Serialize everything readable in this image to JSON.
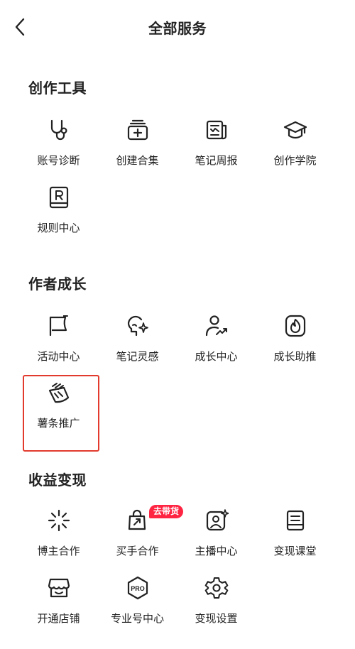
{
  "header": {
    "title": "全部服务",
    "back_icon": "chevron-left-icon"
  },
  "highlight_color": "#e23b2e",
  "badge_color": "#ff2442",
  "sections": [
    {
      "title": "创作工具",
      "items": [
        {
          "label": "账号诊断",
          "icon": "stethoscope-icon"
        },
        {
          "label": "创建合集",
          "icon": "collection-add-icon"
        },
        {
          "label": "笔记周报",
          "icon": "newspaper-icon"
        },
        {
          "label": "创作学院",
          "icon": "graduation-cap-icon"
        },
        {
          "label": "规则中心",
          "icon": "rulebook-icon"
        }
      ]
    },
    {
      "title": "作者成长",
      "items": [
        {
          "label": "活动中心",
          "icon": "flag-icon"
        },
        {
          "label": "笔记灵感",
          "icon": "lightbulb-icon"
        },
        {
          "label": "成长中心",
          "icon": "user-growth-icon"
        },
        {
          "label": "成长助推",
          "icon": "flame-icon"
        },
        {
          "label": "薯条推广",
          "icon": "fries-icon"
        }
      ]
    },
    {
      "title": "收益变现",
      "items": [
        {
          "label": "博主合作",
          "icon": "sparkle-burst-icon"
        },
        {
          "label": "买手合作",
          "icon": "shopping-bag-icon",
          "badge": "去带货"
        },
        {
          "label": "主播中心",
          "icon": "live-host-icon"
        },
        {
          "label": "变现课堂",
          "icon": "notebook-icon"
        },
        {
          "label": "开通店铺",
          "icon": "storefront-icon"
        },
        {
          "label": "专业号中心",
          "icon": "pro-badge-icon",
          "icon_text": "PRO"
        },
        {
          "label": "变现设置",
          "icon": "settings-gear-icon"
        }
      ]
    }
  ]
}
